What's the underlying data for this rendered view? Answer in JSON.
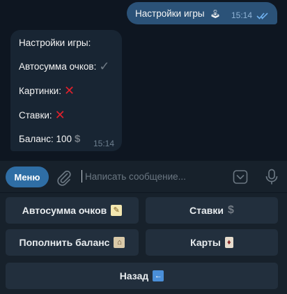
{
  "chat": {
    "outgoing": {
      "text": "Настройки игры",
      "emoji": "🕹",
      "time": "15:14"
    },
    "incoming": {
      "title": "Настройки игры:",
      "autosum_label": "Автосумма очков:",
      "autosum_value": "✓",
      "pictures_label": "Картинки:",
      "pictures_value": "✕",
      "bets_label": "Ставки:",
      "bets_value": "✕",
      "balance_label": "Баланс: 100",
      "balance_icon": "$",
      "time": "15:14"
    }
  },
  "input_bar": {
    "menu_label": "Меню",
    "placeholder": "Написать сообщение..."
  },
  "keyboard": {
    "autosum": {
      "label": "Автосумма очков",
      "emoji": "📝"
    },
    "bets": {
      "label": "Ставки",
      "emoji": "$"
    },
    "topup": {
      "label": "Пополнить баланс",
      "emoji": "🏦"
    },
    "cards": {
      "label": "Карты",
      "emoji": "🂠"
    },
    "back": {
      "label": "Назад",
      "emoji": "⬅"
    }
  },
  "colors": {
    "background": "#0e1621",
    "outgoing_bubble": "#2b5278",
    "incoming_bubble": "#182533",
    "accent": "#2f6ea5",
    "cross": "#e0202c",
    "keyboard_button": "#222f3d"
  }
}
